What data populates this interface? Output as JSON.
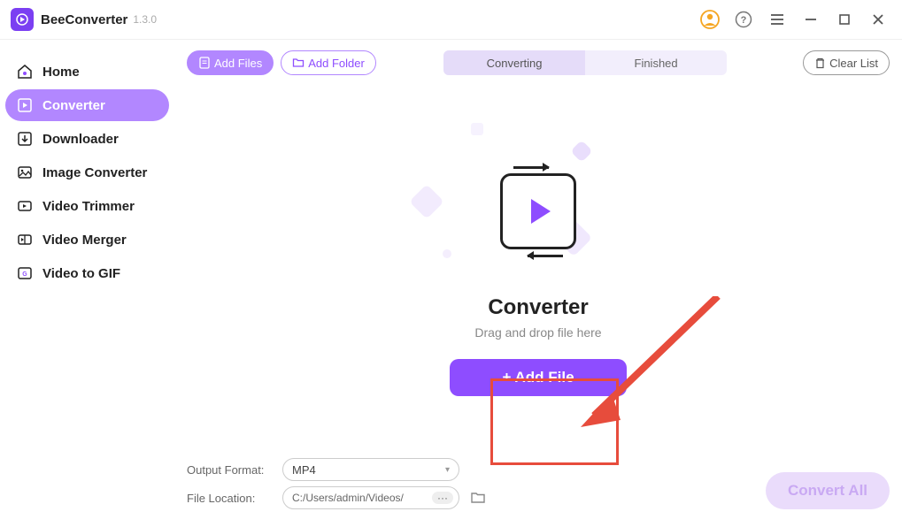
{
  "app": {
    "name": "BeeConverter",
    "version": "1.3.0"
  },
  "sidebar": {
    "items": [
      {
        "label": "Home"
      },
      {
        "label": "Converter"
      },
      {
        "label": "Downloader"
      },
      {
        "label": "Image Converter"
      },
      {
        "label": "Video Trimmer"
      },
      {
        "label": "Video Merger"
      },
      {
        "label": "Video to GIF"
      }
    ]
  },
  "toolbar": {
    "add_files": "Add Files",
    "add_folder": "Add Folder",
    "clear_list": "Clear List"
  },
  "tabs": {
    "converting": "Converting",
    "finished": "Finished"
  },
  "empty": {
    "title": "Converter",
    "subtitle": "Drag and drop file here",
    "add_file": "+ Add File"
  },
  "footer": {
    "output_format_label": "Output Format:",
    "output_format_value": "MP4",
    "file_location_label": "File Location:",
    "file_location_value": "C:/Users/admin/Videos/",
    "convert_all": "Convert All"
  }
}
